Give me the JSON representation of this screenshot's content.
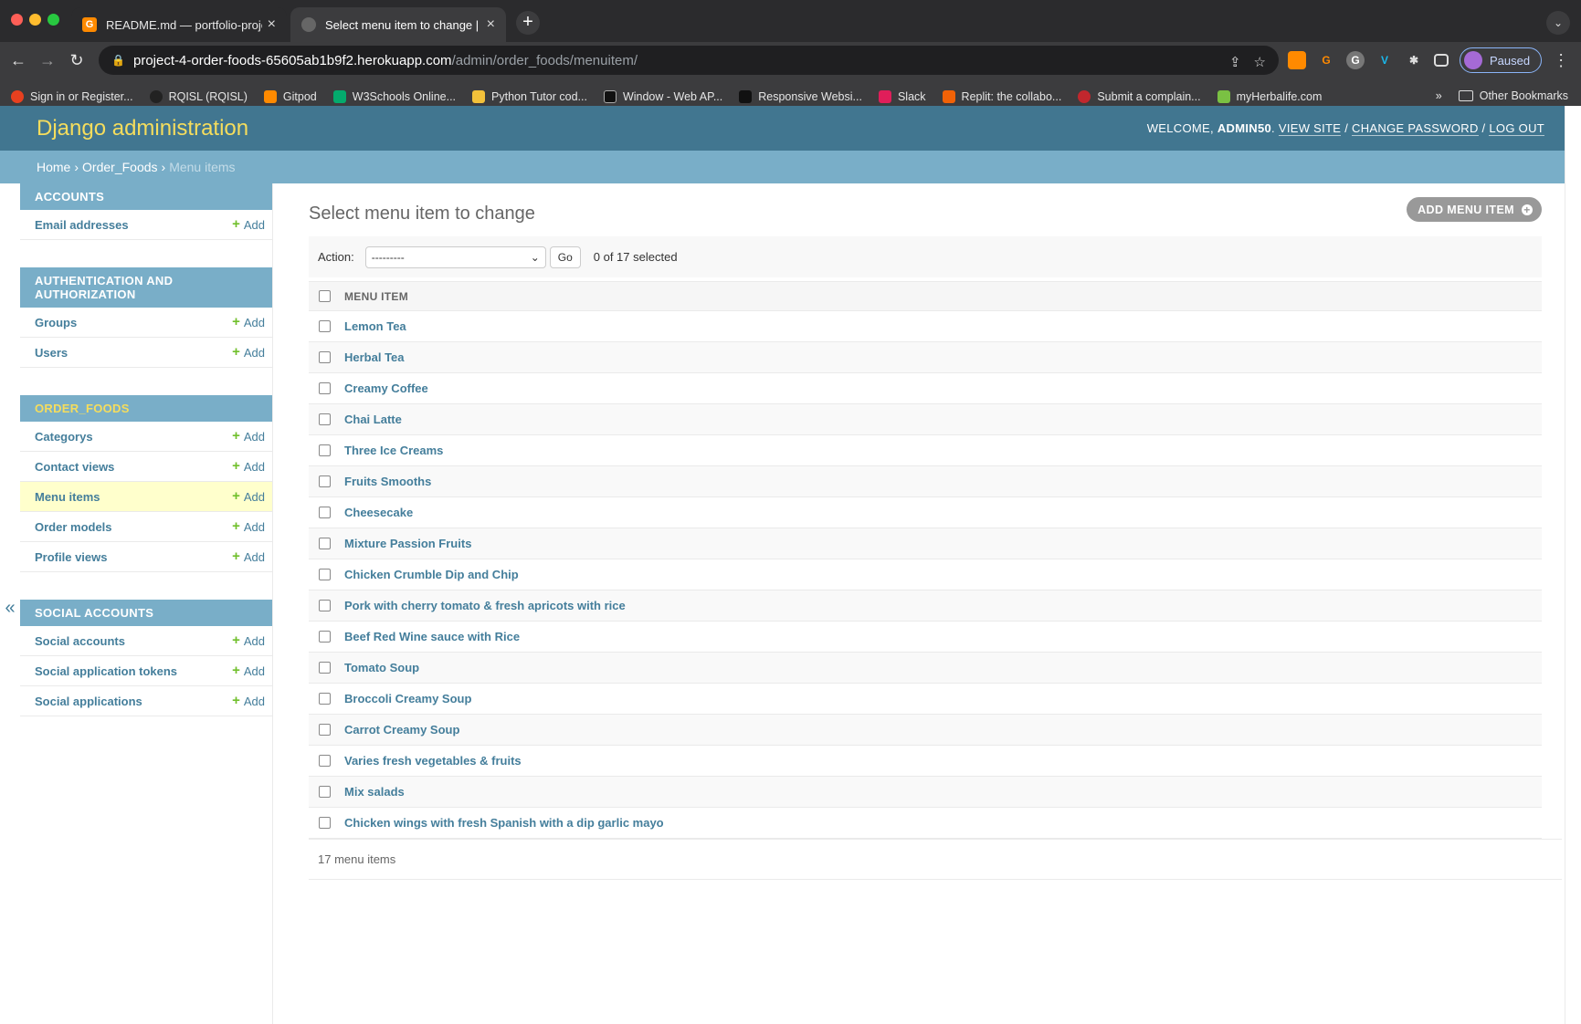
{
  "browser": {
    "tabs": [
      {
        "title": "README.md — portfolio-proje",
        "icon": "gitpod-icon"
      },
      {
        "title": "Select menu item to change | D",
        "icon": "globe-icon"
      }
    ],
    "url_host": "project-4-order-foods-65605ab1b9f2.herokuapp.com",
    "url_path": "/admin/order_foods/menuitem/",
    "profile_label": "Paused",
    "bookmarks": [
      "Sign in or Register...",
      "RQISL (RQISL)",
      "Gitpod",
      "W3Schools Online...",
      "Python Tutor cod...",
      "Window - Web AP...",
      "Responsive Websi...",
      "Slack",
      "Replit: the collabo...",
      "Submit a complain...",
      "myHerbalife.com"
    ],
    "bookmarks_more": "»",
    "other_bookmarks": "Other Bookmarks"
  },
  "admin": {
    "brand": "Django administration",
    "welcome": "WELCOME, ",
    "username": "ADMIN50",
    "view_site": "VIEW SITE",
    "change_password": "CHANGE PASSWORD",
    "log_out": "LOG OUT",
    "sep": " / ",
    "breadcrumbs": {
      "home": "Home",
      "app": "Order_Foods",
      "current": "Menu items"
    }
  },
  "sidebar": {
    "add_label": "Add",
    "modules": [
      {
        "caption": "ACCOUNTS",
        "items": [
          "Email addresses"
        ]
      },
      {
        "caption": "AUTHENTICATION AND AUTHORIZATION",
        "items": [
          "Groups",
          "Users"
        ]
      },
      {
        "caption": "ORDER_FOODS",
        "items": [
          "Categorys",
          "Contact views",
          "Menu items",
          "Order models",
          "Profile views"
        ]
      },
      {
        "caption": "SOCIAL ACCOUNTS",
        "items": [
          "Social accounts",
          "Social application tokens",
          "Social applications"
        ]
      }
    ],
    "collapse": "«"
  },
  "content": {
    "title": "Select menu item to change",
    "add_button": "ADD MENU ITEM",
    "action_label": "Action:",
    "action_value": "---------",
    "go": "Go",
    "selected": "0 of 17 selected",
    "column_header": "MENU ITEM",
    "items": [
      "Lemon Tea",
      "Herbal Tea",
      "Creamy Coffee",
      "Chai Latte",
      "Three Ice Creams",
      "Fruits Smooths",
      "Cheesecake",
      "Mixture Passion Fruits",
      "Chicken Crumble Dip and Chip",
      "Pork with cherry tomato & fresh apricots with rice",
      "Beef Red Wine sauce with Rice",
      "Tomato Soup",
      "Broccoli Creamy Soup",
      "Carrot Creamy Soup",
      "Varies fresh vegetables & fruits",
      "Mix salads",
      "Chicken wings with fresh Spanish with a dip garlic mayo"
    ],
    "count": "17 menu items"
  },
  "colors": {
    "header": "#417690",
    "brand": "#f5dd5d",
    "breadcrumbs": "#79aec8",
    "link": "#447e9b",
    "add_green": "#70bf2b",
    "selected_row": "#ffffcc"
  }
}
